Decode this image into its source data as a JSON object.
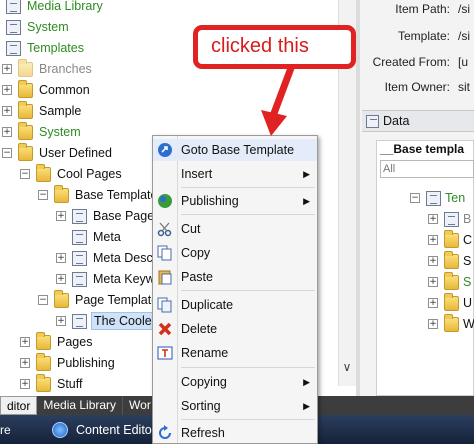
{
  "tree": {
    "nodes": [
      {
        "label": "Media Library",
        "kind": "media",
        "color": "green"
      },
      {
        "label": "System",
        "kind": "system",
        "color": "green"
      },
      {
        "label": "Templates",
        "kind": "templates",
        "color": "green"
      },
      {
        "label": "Branches",
        "kind": "branches",
        "color": "grey"
      },
      {
        "label": "Common",
        "kind": "folder"
      },
      {
        "label": "Sample",
        "kind": "folder"
      },
      {
        "label": "System",
        "kind": "system",
        "color": "green"
      },
      {
        "label": "User Defined",
        "kind": "folder"
      },
      {
        "label": "Cool Pages",
        "kind": "folder"
      },
      {
        "label": "Base Template",
        "kind": "folder"
      },
      {
        "label": "Base Page",
        "kind": "template"
      },
      {
        "label": "Meta",
        "kind": "template"
      },
      {
        "label": "Meta Descr",
        "kind": "template"
      },
      {
        "label": "Meta Keyw",
        "kind": "template"
      },
      {
        "label": "Page Template",
        "kind": "folder"
      },
      {
        "label": "The Cooles",
        "kind": "template",
        "selected": true
      },
      {
        "label": "Pages",
        "kind": "folder"
      },
      {
        "label": "Publishing",
        "kind": "folder"
      },
      {
        "label": "Stuff",
        "kind": "folder"
      }
    ]
  },
  "right_panel": {
    "fields": [
      {
        "label": "Item Path:",
        "value": "/si"
      },
      {
        "label": "Template:",
        "value": "/si"
      },
      {
        "label": "Created From:",
        "value": "[u"
      },
      {
        "label": "Item Owner:",
        "value": "sit"
      }
    ],
    "data_header": "Data",
    "section_title": "__Base templa",
    "filter_value": "All",
    "tree_items": [
      "Ten",
      "B",
      "C",
      "S",
      "S",
      "U",
      "W"
    ]
  },
  "context_menu": {
    "items": [
      {
        "label": "Goto Base Template",
        "icon": "goto-icon"
      },
      {
        "label": "Insert",
        "icon": "",
        "submenu": true
      },
      {
        "label": "Publishing",
        "icon": "globe-icon",
        "submenu": true
      },
      {
        "label": "Cut",
        "icon": "scissors-icon"
      },
      {
        "label": "Copy",
        "icon": "copy-icon"
      },
      {
        "label": "Paste",
        "icon": "paste-icon"
      },
      {
        "label": "Duplicate",
        "icon": "duplicate-icon"
      },
      {
        "label": "Delete",
        "icon": "delete-icon"
      },
      {
        "label": "Rename",
        "icon": "rename-icon"
      },
      {
        "label": "Copying",
        "icon": "",
        "submenu": true
      },
      {
        "label": "Sorting",
        "icon": "",
        "submenu": true
      },
      {
        "label": "Refresh",
        "icon": "refresh-icon"
      }
    ]
  },
  "callout": {
    "text": "clicked this",
    "color": "#e02222"
  },
  "bottom_tabs": [
    "ditor",
    "Media Library",
    "Wor"
  ],
  "taskbar": {
    "start_text": "re",
    "button_label": "Content Editor"
  },
  "colors": {
    "green_text": "#2e8b22",
    "selection": "#cfe2f7",
    "menu_bg": "#f5f5f5"
  }
}
